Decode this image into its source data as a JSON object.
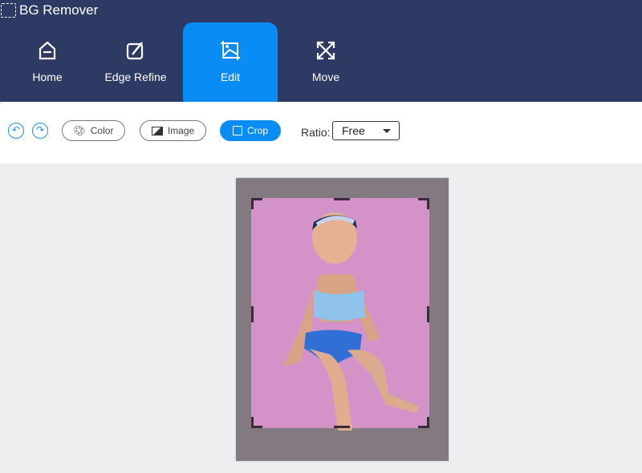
{
  "app": {
    "title": "BG Remover"
  },
  "tabs": [
    {
      "label": "Home",
      "icon": "home-icon"
    },
    {
      "label": "Edge Refine",
      "icon": "brush-icon"
    },
    {
      "label": "Edit",
      "icon": "image-edit-icon",
      "active": true
    },
    {
      "label": "Move",
      "icon": "move-icon"
    }
  ],
  "toolbar": {
    "color_label": "Color",
    "image_label": "Image",
    "crop_label": "Crop",
    "ratio_label": "Ratio:",
    "ratio_value": "Free"
  },
  "colors": {
    "header": "#2d3a63",
    "accent": "#0a8cf5",
    "background_fill": "#d393c8"
  }
}
